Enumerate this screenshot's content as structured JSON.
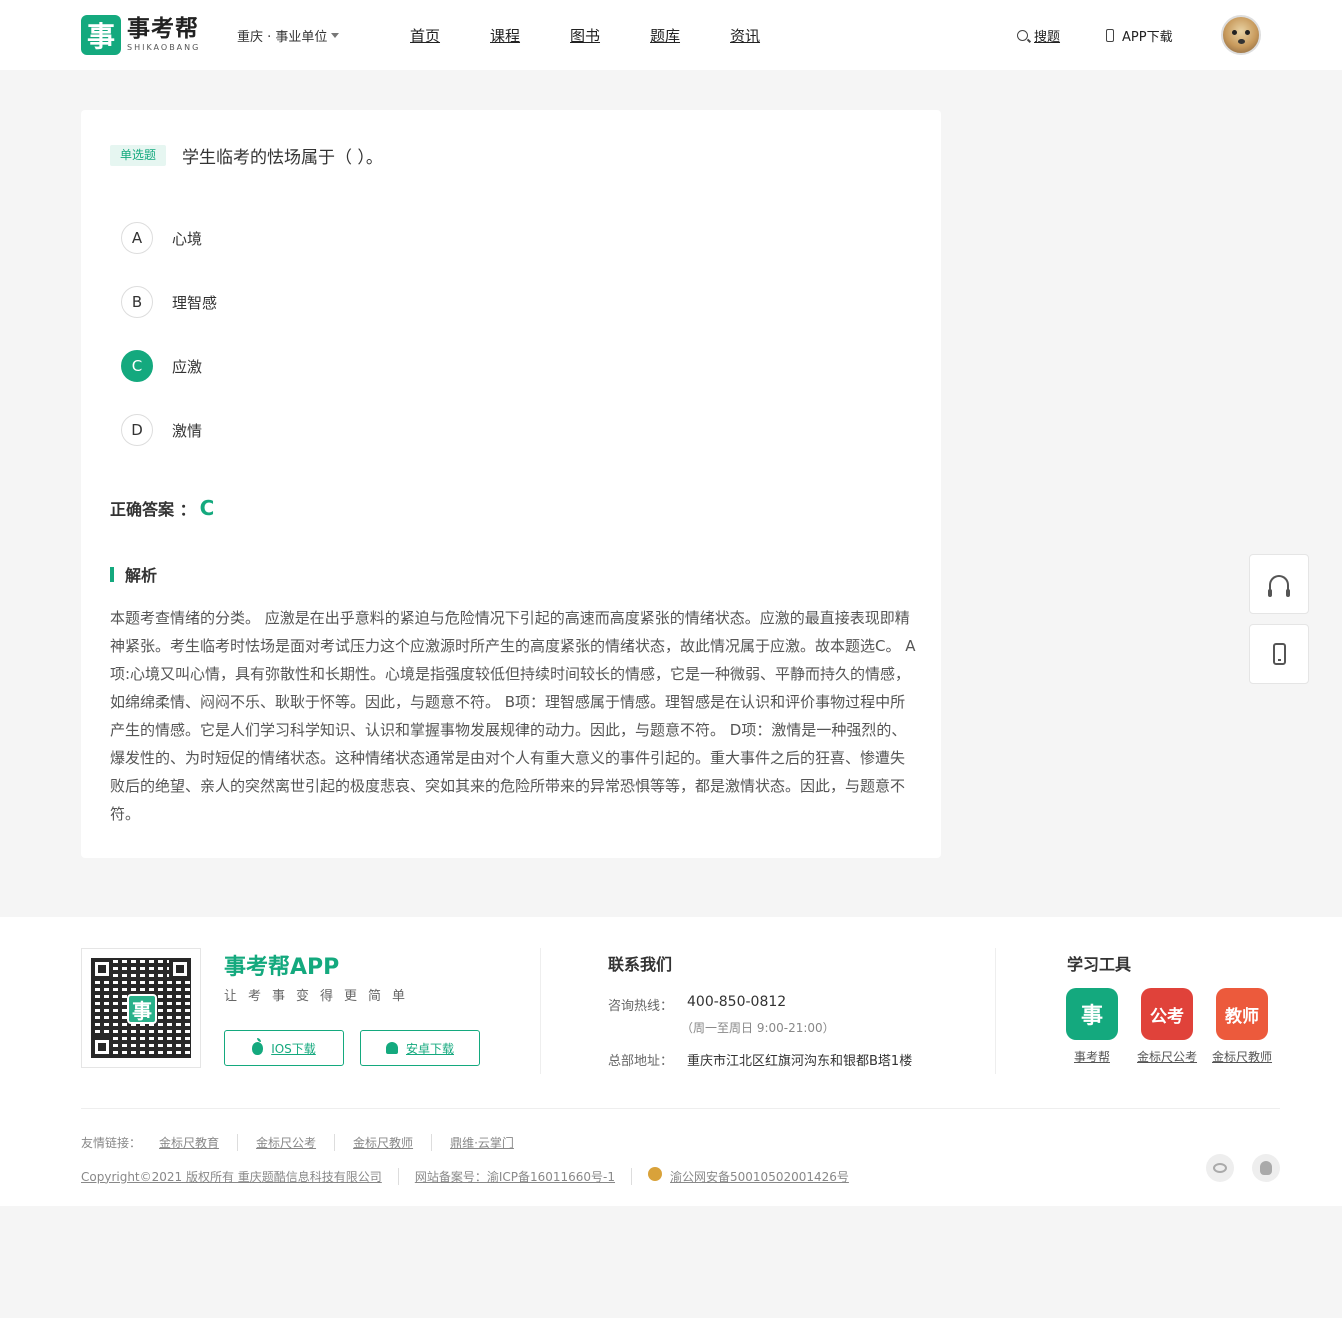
{
  "header": {
    "logo_cn": "事考帮",
    "logo_en": "SHIKAOBANG",
    "logo_mark": "事",
    "region": "重庆 · 事业单位",
    "nav": [
      "首页",
      "课程",
      "图书",
      "题库",
      "资讯"
    ],
    "search_label": "搜题",
    "app_label": "APP下载",
    "icons": {
      "search": "search-icon",
      "app": "phone-icon",
      "region": "chevron-down-icon"
    }
  },
  "question": {
    "type_tag": "单选题",
    "title": "学生临考的怯场属于（  ）。",
    "options": [
      {
        "letter": "A",
        "text": "心境",
        "selected": false
      },
      {
        "letter": "B",
        "text": "理智感",
        "selected": false
      },
      {
        "letter": "C",
        "text": "应激",
        "selected": true
      },
      {
        "letter": "D",
        "text": "激情",
        "selected": false
      }
    ],
    "answer_label": "正确答案 ：",
    "answer_value": "C",
    "analysis_title": "解析",
    "analysis_text": "本题考查情绪的分类。 应激是在出乎意料的紧迫与危险情况下引起的高速而高度紧张的情绪状态。应激的最直接表现即精神紧张。考生临考时怯场是面对考试压力这个应激源时所产生的高度紧张的情绪状态，故此情况属于应激。故本题选C。 A项:心境又叫心情，具有弥散性和长期性。心境是指强度较低但持续时间较长的情感，它是一种微弱、平静而持久的情感，如绵绵柔情、闷闷不乐、耿耿于怀等。因此，与题意不符。 B项：理智感属于情感。理智感是在认识和评价事物过程中所产生的情感。它是人们学习科学知识、认识和掌握事物发展规律的动力。因此，与题意不符。 D项：激情是一种强烈的、爆发性的、为时短促的情绪状态。这种情绪状态通常是由对个人有重大意义的事件引起的。重大事件之后的狂喜、惨遭失败后的绝望、亲人的突然离世引起的极度悲哀、突如其来的危险所带来的异常恐惧等等，都是激情状态。因此，与题意不符。"
  },
  "float": {
    "service_icon": "headset-icon",
    "app_icon": "mobile-icon"
  },
  "footer": {
    "app_name": "事考帮APP",
    "slogan": "让考事变得更简单",
    "qr_mark": "事",
    "ios_label": "IOS下载",
    "android_label": "安卓下载",
    "contact_title": "联系我们",
    "hotline_label": "咨询热线：",
    "hotline_value": "400-850-0812",
    "hours": "（周一至周日 9:00-21:00）",
    "address_label": "总部地址：",
    "address_value": "重庆市江北区红旗河沟东和银都B塔1楼",
    "tools_title": "学习工具",
    "tools": [
      {
        "label": "事考帮",
        "mark": "事",
        "color": "#14a97e"
      },
      {
        "label": "金标尺公考",
        "mark": "公考",
        "color": "#e0423a"
      },
      {
        "label": "金标尺教师",
        "mark": "教师",
        "color": "#ec5a3c"
      }
    ],
    "links_label": "友情链接：",
    "links": [
      "金标尺教育",
      "金标尺公考",
      "金标尺教师",
      "鼎维·云掌门"
    ],
    "copyright": "Copyright©2021 版权所有 重庆题酷信息科技有限公司",
    "icp": "网站备案号：渝ICP备16011660号-1",
    "police": "渝公网安备50010502001426号"
  },
  "colors": {
    "accent": "#14a97e",
    "background": "#f5f5f5"
  }
}
